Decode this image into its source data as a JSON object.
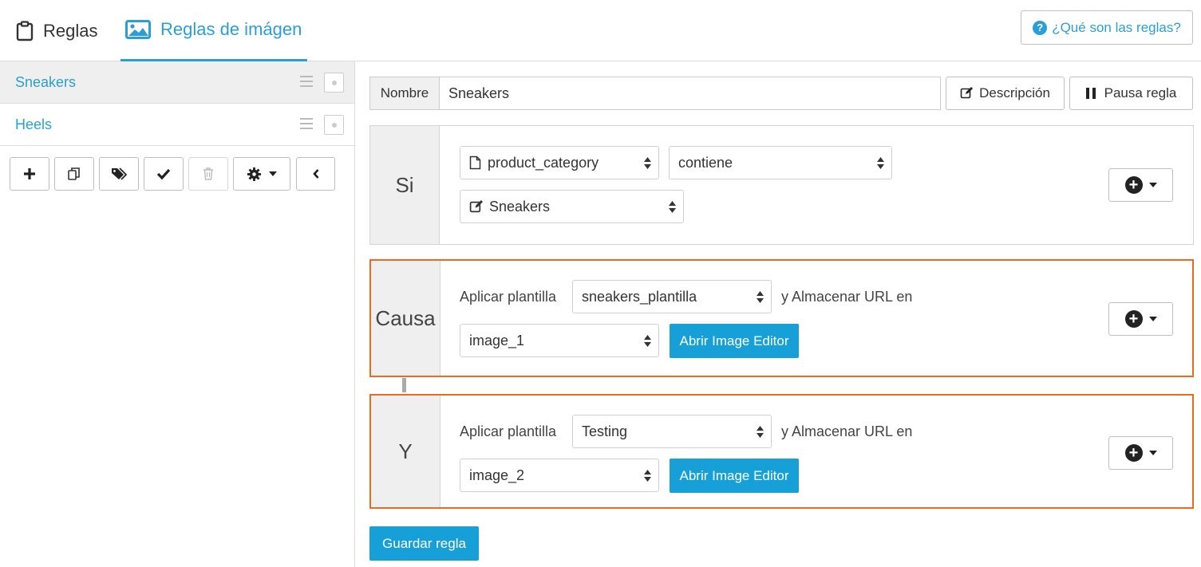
{
  "tabs": [
    {
      "label": "Reglas",
      "icon": "clipboard-icon",
      "active": false
    },
    {
      "label": "Reglas de imágen",
      "icon": "image-icon",
      "active": true
    }
  ],
  "help": {
    "label": "¿Qué son las reglas?",
    "icon": "question-circle-icon"
  },
  "sidebar": {
    "rules": [
      {
        "label": "Sneakers",
        "active": true
      },
      {
        "label": "Heels",
        "active": false
      }
    ],
    "toolbar": [
      {
        "icon": "plus-icon"
      },
      {
        "icon": "copy-icon"
      },
      {
        "icon": "tags-icon"
      },
      {
        "icon": "check-icon"
      },
      {
        "icon": "trash-icon",
        "disabled": true
      },
      {
        "icon": "gear-dropdown-icon"
      },
      {
        "icon": "chevron-left-icon"
      }
    ]
  },
  "editor": {
    "name_label": "Nombre",
    "name_value": "Sneakers",
    "description_label": "Descripción",
    "pause_label": "Pausa regla",
    "if_block": {
      "label": "Si",
      "field": "product_category",
      "operator": "contiene",
      "value": "Sneakers"
    },
    "cause_block": {
      "label": "Causa",
      "apply_label": "Aplicar plantilla",
      "template": "sneakers_plantilla",
      "store_label": "y Almacenar URL en",
      "target": "image_1",
      "editor_button": "Abrir Image Editor"
    },
    "and_block": {
      "label": "Y",
      "apply_label": "Aplicar plantilla",
      "template": "Testing",
      "store_label": "y Almacenar URL en",
      "target": "image_2",
      "editor_button": "Abrir Image Editor"
    },
    "save_label": "Guardar regla"
  },
  "colors": {
    "accent": "#2a9fd6",
    "button_blue": "#179fd8",
    "highlight": "#ec6a22"
  }
}
